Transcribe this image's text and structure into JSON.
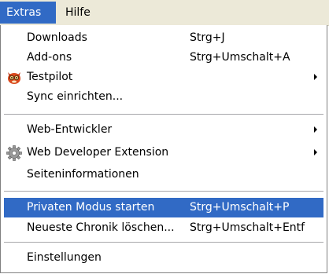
{
  "menubar": {
    "items": [
      {
        "label": "Extras"
      },
      {
        "label": "Hilfe"
      }
    ]
  },
  "dropdown": {
    "items": [
      {
        "label": "Downloads",
        "shortcut": "Strg+J"
      },
      {
        "label": "Add-ons",
        "shortcut": "Strg+Umschalt+A"
      },
      {
        "label": "Testpilot",
        "icon": "testpilot-fox-icon",
        "submenu": true
      },
      {
        "label": "Sync einrichten..."
      },
      {
        "label": "Web-Entwickler",
        "submenu": true
      },
      {
        "label": "Web Developer Extension",
        "icon": "gear-icon",
        "submenu": true
      },
      {
        "label": "Seiteninformationen"
      },
      {
        "label": "Privaten Modus starten",
        "shortcut": "Strg+Umschalt+P",
        "highlighted": true
      },
      {
        "label": "Neueste Chronik löschen...",
        "shortcut": "Strg+Umschalt+Entf"
      },
      {
        "label": "Einstellungen"
      }
    ]
  },
  "colors": {
    "menubar_bg": "#ece9d8",
    "selection": "#316ac5",
    "selection_text": "#ffffff"
  }
}
